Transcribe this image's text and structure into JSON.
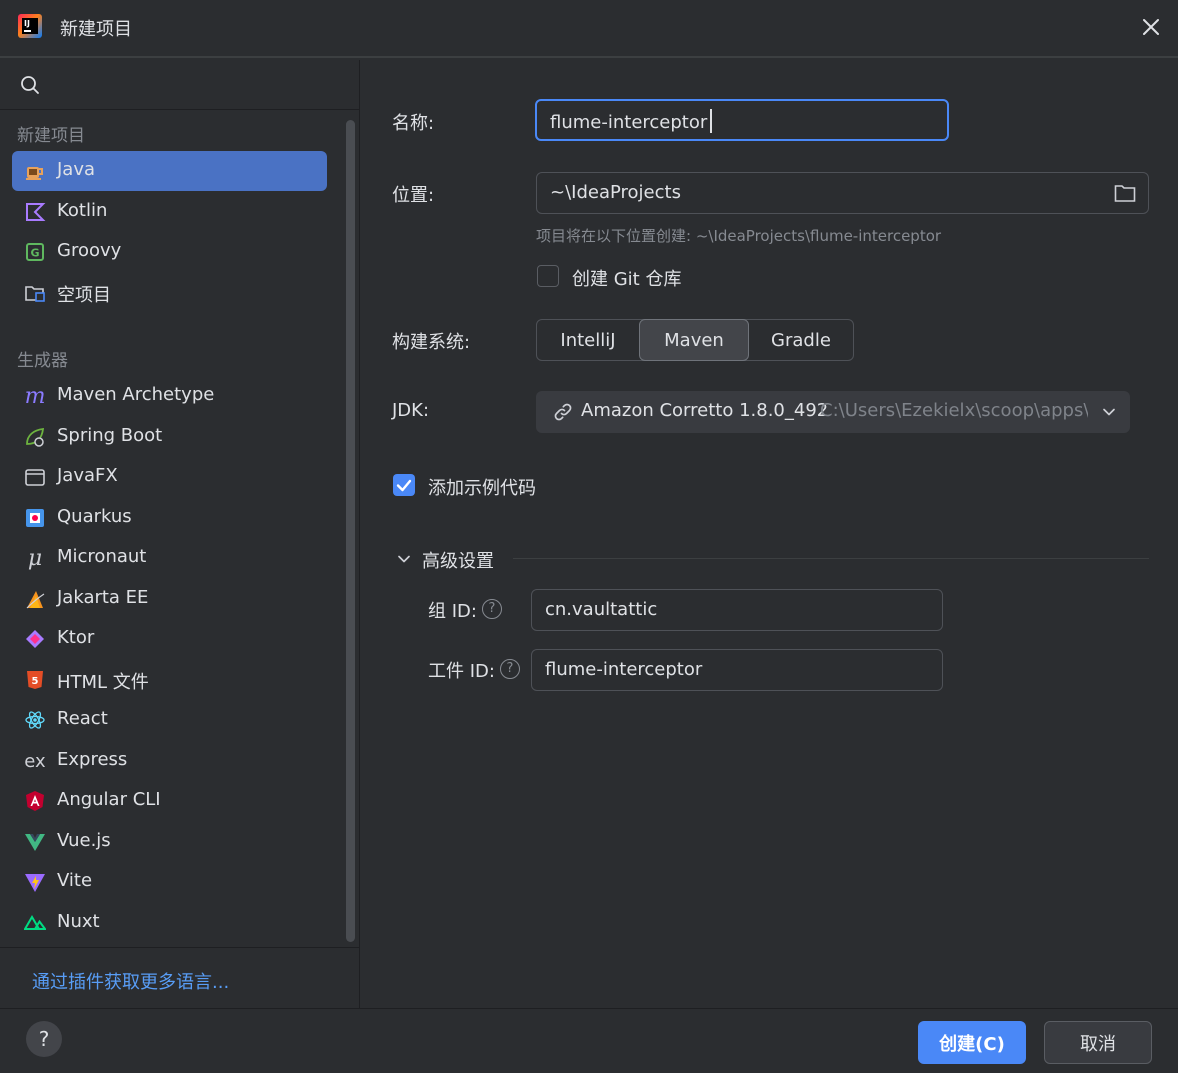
{
  "window": {
    "title": "新建项目"
  },
  "sidebar": {
    "section_new": "新建项目",
    "new_items": [
      {
        "label": "Java",
        "icon": "java-cup-icon",
        "selected": true
      },
      {
        "label": "Kotlin",
        "icon": "kotlin-icon"
      },
      {
        "label": "Groovy",
        "icon": "groovy-icon"
      },
      {
        "label": "空项目",
        "icon": "empty-project-icon"
      }
    ],
    "section_generators": "生成器",
    "generators": [
      {
        "label": "Maven Archetype",
        "icon": "maven-icon"
      },
      {
        "label": "Spring Boot",
        "icon": "spring-boot-icon"
      },
      {
        "label": "JavaFX",
        "icon": "javafx-window-icon"
      },
      {
        "label": "Quarkus",
        "icon": "quarkus-icon"
      },
      {
        "label": "Micronaut",
        "icon": "micronaut-icon"
      },
      {
        "label": "Jakarta EE",
        "icon": "jakarta-ee-icon"
      },
      {
        "label": "Ktor",
        "icon": "ktor-icon"
      },
      {
        "label": "HTML 文件",
        "icon": "html5-icon"
      },
      {
        "label": "React",
        "icon": "react-icon"
      },
      {
        "label": "Express",
        "icon": "express-icon"
      },
      {
        "label": "Angular CLI",
        "icon": "angular-icon"
      },
      {
        "label": "Vue.js",
        "icon": "vue-icon"
      },
      {
        "label": "Vite",
        "icon": "vite-icon"
      },
      {
        "label": "Nuxt",
        "icon": "nuxt-icon"
      }
    ],
    "plugins_link": "通过插件获取更多语言..."
  },
  "form": {
    "name_label": "名称:",
    "name_value": "flume-interceptor",
    "location_label": "位置:",
    "location_value": "~\\IdeaProjects",
    "location_hint": "项目将在以下位置创建: ~\\IdeaProjects\\flume-interceptor",
    "git_label": "创建 Git 仓库",
    "git_checked": false,
    "build_label": "构建系统:",
    "build_options": [
      "IntelliJ",
      "Maven",
      "Gradle"
    ],
    "build_selected": "Maven",
    "jdk_label": "JDK:",
    "jdk_name": "Amazon Corretto 1.8.0_492",
    "jdk_path": "C:\\Users\\Ezekielx\\scoop\\apps\\c",
    "sample_label": "添加示例代码",
    "sample_checked": true,
    "advanced_label": "高级设置",
    "group_label": "组 ID:",
    "group_value": "cn.vaultattic",
    "artifact_label": "工件 ID:",
    "artifact_value": "flume-interceptor"
  },
  "footer": {
    "help": "?",
    "create": "创建(C)",
    "cancel": "取消"
  },
  "colors": {
    "accent": "#4a88f7",
    "selection": "#4a72c4",
    "background": "#2b2d30",
    "link": "#589df6"
  }
}
